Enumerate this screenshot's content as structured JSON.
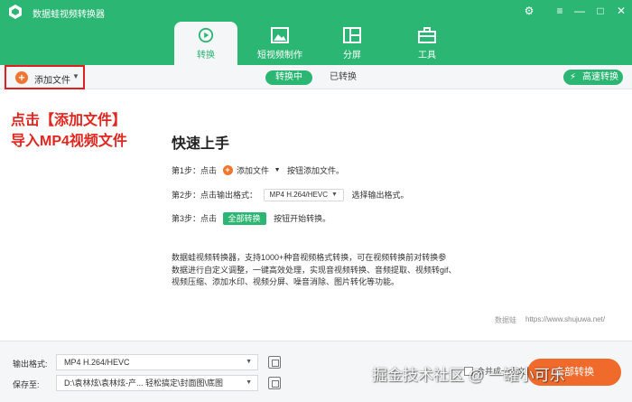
{
  "window": {
    "title": "数据蛙视频转换器",
    "controls": [
      "⚙",
      "≡",
      "—",
      "□",
      "✕"
    ]
  },
  "nav": {
    "tabs": [
      {
        "label": "转换",
        "icon": "convert-icon",
        "active": true
      },
      {
        "label": "短视频制作",
        "icon": "image-icon",
        "active": false
      },
      {
        "label": "分屏",
        "icon": "split-screen-icon",
        "active": false
      },
      {
        "label": "工具",
        "icon": "toolbox-icon",
        "active": false
      }
    ]
  },
  "toolbar": {
    "add_file": "添加文件",
    "converting": "转换中",
    "converted": "已转换",
    "fast_convert": "高速转换"
  },
  "annotation": {
    "line1": "点击【添加文件】",
    "line2": "导入MP4视频文件"
  },
  "quickstart": {
    "title": "快速上手",
    "step1": {
      "prefix": "第1步：点击",
      "button": "添加文件",
      "suffix": "按钮添加文件。"
    },
    "step2": {
      "prefix": "第2步：点击输出格式：",
      "format": "MP4 H.264/HEVC",
      "suffix": "选择输出格式。"
    },
    "step3": {
      "prefix": "第3步：点击",
      "button": "全部转换",
      "suffix": "按钮开始转换。"
    },
    "desc_lines": [
      "数据蛙视频转换器，支持1000+种音视频格式转换，可在视频转换前对转换参",
      "数据进行自定义调整，一键高效处理，实现音视频转换、音频提取、视频转gif、",
      "视频压缩、添加水印、视频分屏、噪音消除、图片转化等功能。"
    ]
  },
  "brand": {
    "mark": "数据蛙",
    "url": "https://www.shujuwa.net/"
  },
  "bottom": {
    "output_format_label": "输出格式:",
    "output_format_value": "MP4 H.264/HEVC",
    "save_to_label": "保存至:",
    "save_to_value": "D:\\袁林炫\\袁林炫-产... 轻松搞定\\封面图\\底图",
    "merge_label": "合并成一个文件",
    "convert_all": "全部转换"
  },
  "watermark": "掘金技术社区 @ 一罐小可乐",
  "colors": {
    "brand_green": "#2bb673",
    "accent_orange": "#f06a2c",
    "annotation_red": "#e0271f"
  }
}
